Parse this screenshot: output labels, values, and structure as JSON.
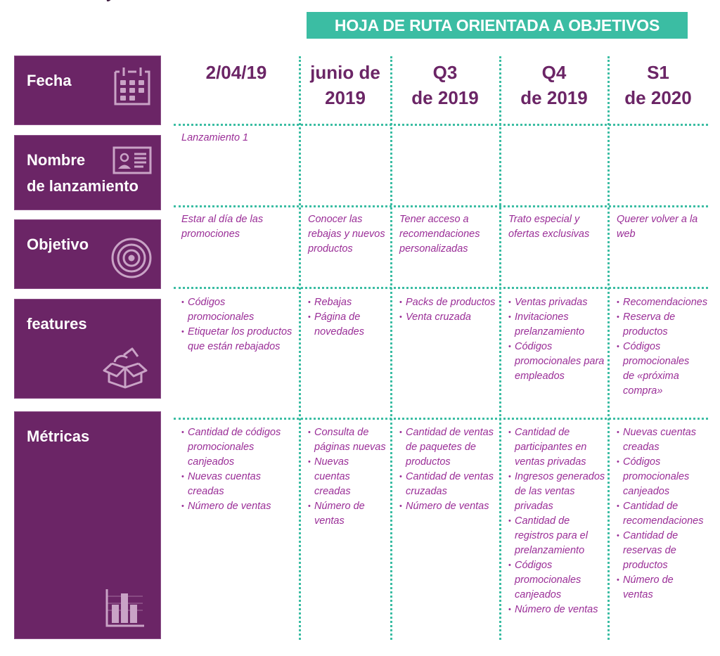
{
  "banner": {
    "title": "HOJA DE RUTA ORIENTADA A OBJETIVOS"
  },
  "colors": {
    "accent": "#3bbda3",
    "primary": "#6b2566",
    "text": "#9a2e97"
  },
  "rows": [
    {
      "label": "Fecha",
      "icon": "calendar-icon"
    },
    {
      "label_line1": "Nombre",
      "label_line2": "de lanzamiento",
      "icon": "id-card-icon"
    },
    {
      "label": "Objetivo",
      "icon": "target-icon"
    },
    {
      "label": "features",
      "icon": "open-box-icon"
    },
    {
      "label": "Métricas",
      "icon": "bar-chart-icon"
    }
  ],
  "columns": [
    {
      "line1": "2/04/19",
      "line2": ""
    },
    {
      "line1": "junio de",
      "line2": "2019"
    },
    {
      "line1": "Q3",
      "line2": "de 2019"
    },
    {
      "line1": "Q4",
      "line2": "de 2019"
    },
    {
      "line1": "S1",
      "line2": "de 2020"
    }
  ],
  "release_names": [
    "Lanzamiento 1",
    "",
    "",
    "",
    ""
  ],
  "objectives": [
    "Estar al día de las promociones",
    "Conocer las rebajas y nuevos productos",
    "Tener acceso a recomendaciones personalizadas",
    "Trato especial y ofertas exclusivas",
    "Querer volver a la web"
  ],
  "features": [
    [
      "Códigos promocionales",
      "Etiquetar los productos que están rebajados"
    ],
    [
      "Rebajas",
      "Página de novedades"
    ],
    [
      "Packs de productos",
      "Venta cruzada"
    ],
    [
      "Ventas privadas",
      "Invitaciones prelanzamiento",
      "Códigos promocionales para empleados"
    ],
    [
      "Recomendaciones",
      "Reserva de productos",
      "Códigos promocionales de «próxima compra»"
    ]
  ],
  "metrics": [
    [
      "Cantidad de códigos promocionales canjeados",
      "Nuevas cuentas creadas",
      "Número de ventas"
    ],
    [
      "Consulta de páginas nuevas",
      "Nuevas cuentas creadas",
      "Número de ventas"
    ],
    [
      "Cantidad de ventas de paquetes de productos",
      "Cantidad de ventas cruzadas",
      "Número de ventas"
    ],
    [
      "Cantidad de participantes en ventas privadas",
      "Ingresos generados de las ventas privadas",
      "Cantidad de registros para el prelanzamiento",
      "Códigos promocionales canjeados",
      "Número de ventas"
    ],
    [
      "Nuevas cuentas creadas",
      "Códigos promocionales canjeados",
      "Cantidad de recomendaciones",
      "Cantidad de reservas de productos",
      "Número de ventas"
    ]
  ]
}
